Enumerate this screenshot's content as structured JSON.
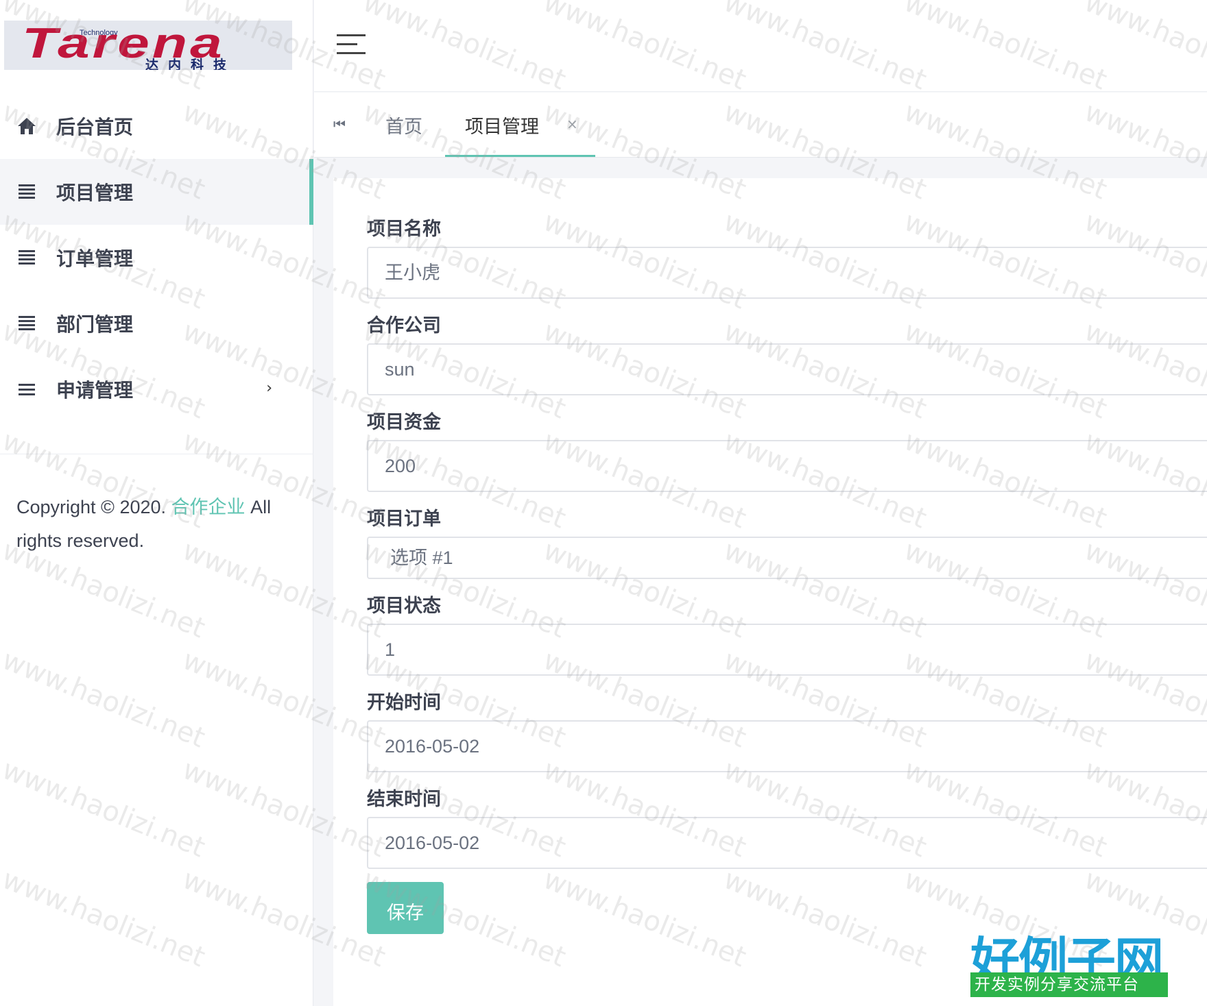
{
  "brand": {
    "logo_word": "Tarena",
    "logo_tagline": "Technology",
    "logo_cn": "达内科技"
  },
  "sidebar": {
    "items": [
      {
        "label": "后台首页",
        "icon": "home-icon",
        "active": false
      },
      {
        "label": "项目管理",
        "icon": "list-icon",
        "active": true
      },
      {
        "label": "订单管理",
        "icon": "list-icon",
        "active": false
      },
      {
        "label": "部门管理",
        "icon": "list-icon",
        "active": false
      },
      {
        "label": "申请管理",
        "icon": "menu-icon",
        "active": false,
        "has_submenu": true
      }
    ],
    "submenu_arrow": "›",
    "copyright_prefix": "Copyright © 2020.",
    "copyright_link": "合作企业",
    "copyright_suffix": "All rights reserved."
  },
  "tabs": {
    "nav_icon": "⏮",
    "items": [
      {
        "label": "首页",
        "active": false
      },
      {
        "label": "项目管理",
        "active": true,
        "closable": true
      }
    ],
    "close_glyph": "×"
  },
  "form": {
    "fields": [
      {
        "label": "项目名称",
        "value": "王小虎"
      },
      {
        "label": "合作公司",
        "value": "sun"
      },
      {
        "label": "项目资金",
        "value": "200"
      },
      {
        "label": "项目订单",
        "value": "选项 #1"
      },
      {
        "label": "项目状态",
        "value": "1"
      },
      {
        "label": "开始时间",
        "value": "2016-05-02"
      },
      {
        "label": "结束时间",
        "value": "2016-05-02"
      }
    ],
    "save_label": "保存"
  },
  "watermark": {
    "text": "www.haolizi.net",
    "site_name": "好例子网",
    "site_slogan": "开发实例分享交流平台"
  },
  "colors": {
    "accent": "#5fc4b2",
    "background": "#f4f5f8"
  }
}
